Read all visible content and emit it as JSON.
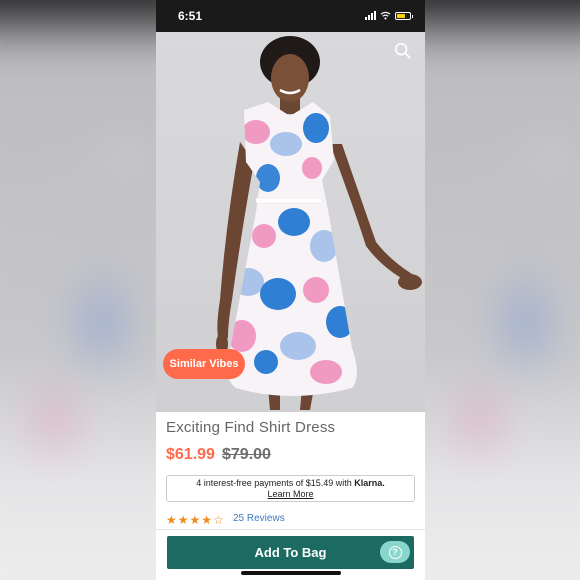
{
  "status_bar": {
    "time": "6:51",
    "battery_level": 0.7
  },
  "hero": {
    "badge_label": "Similar Vibes"
  },
  "product": {
    "title": "Exciting Find Shirt Dress",
    "sale_price": "$61.99",
    "original_price": "$79.00"
  },
  "klarna": {
    "message": "4 interest-free payments of $15.49 with ",
    "brand": "Klarna.",
    "learn_more": "Learn More"
  },
  "rating": {
    "stars": 4,
    "max": 5,
    "reviews_label": "25 Reviews"
  },
  "cta": {
    "add_to_bag": "Add To Bag"
  },
  "colors": {
    "accent": "#ff6b4a",
    "button": "#1b6b63",
    "help": "#88d6cc",
    "star": "#f08c1a",
    "link": "#3a7bbf"
  },
  "icons": [
    "search-icon",
    "help-icon",
    "star-icon",
    "wifi-icon",
    "battery-icon",
    "signal-icon"
  ]
}
